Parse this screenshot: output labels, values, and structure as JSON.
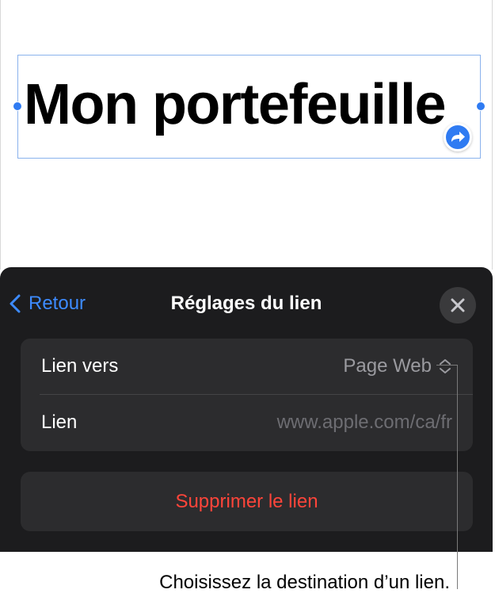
{
  "canvas": {
    "title_text": "Mon portefeuille"
  },
  "sheet": {
    "back_label": "Retour",
    "title": "Réglages du lien",
    "rows": [
      {
        "label": "Lien vers",
        "value": "Page Web"
      },
      {
        "label": "Lien",
        "value": "www.apple.com/ca/fr"
      }
    ],
    "delete_label": "Supprimer le lien"
  },
  "callout": {
    "caption": "Choisissez la destination d’un lien."
  },
  "colors": {
    "accent": "#2f7bf2",
    "link_blue": "#3d8bff",
    "destructive": "#ff453a",
    "sheet_bg": "#1c1c1e",
    "group_bg": "#2c2c2e"
  },
  "icons": {
    "back": "chevron-left-icon",
    "close": "close-icon",
    "link_badge": "curved-arrow-icon",
    "picker": "chevron-up-down-icon"
  }
}
